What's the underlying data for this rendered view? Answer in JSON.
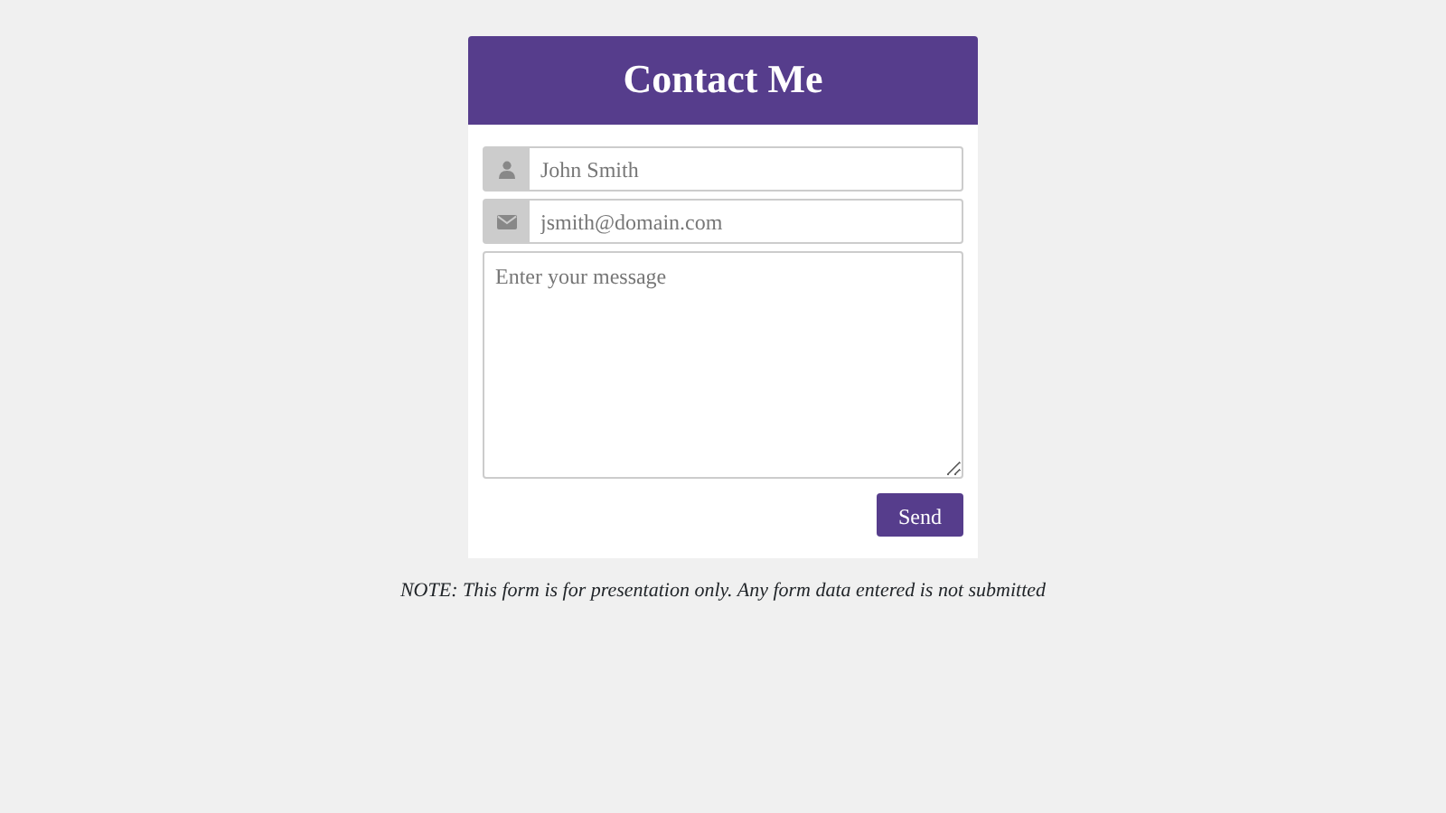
{
  "title": "Contact Me",
  "fields": [
    {
      "kind": "name",
      "placeholder": "John Smith"
    },
    {
      "kind": "email",
      "placeholder": "jsmith@domain.com"
    },
    {
      "kind": "textarea",
      "placeholder": "Enter your message"
    }
  ],
  "button": "Send",
  "note": "NOTE: This form is for presentation only. Any form data entered is not submitted"
}
